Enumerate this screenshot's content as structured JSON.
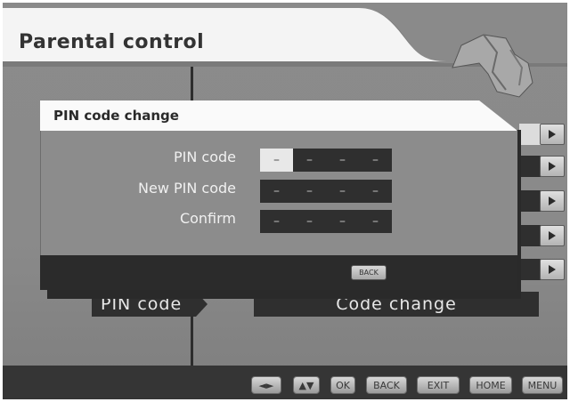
{
  "header": {
    "title": "Parental control"
  },
  "dialog": {
    "title": "PIN code change",
    "fields": [
      {
        "label": "PIN code",
        "digits": [
          "–",
          "–",
          "–",
          "–"
        ],
        "active_index": 0
      },
      {
        "label": "New PIN code",
        "digits": [
          "–",
          "–",
          "–",
          "–"
        ]
      },
      {
        "label": "Confirm",
        "digits": [
          "–",
          "–",
          "–",
          "–"
        ]
      }
    ],
    "back_label": "BACK"
  },
  "background_row": {
    "label": "PIN code",
    "value": "Code change"
  },
  "bottom_bar": {
    "keys": [
      {
        "label": "◄►",
        "icon": "left-right-arrows-icon"
      },
      {
        "label": "▲▼",
        "icon": "up-down-arrows-icon"
      },
      {
        "label": "OK"
      },
      {
        "label": "BACK"
      },
      {
        "label": "EXIT"
      },
      {
        "label": "HOME"
      },
      {
        "label": "MENU"
      }
    ]
  },
  "colors": {
    "panel": "#8a8a8a",
    "dark": "#2f2f2f",
    "header": "#f4f4f4"
  }
}
